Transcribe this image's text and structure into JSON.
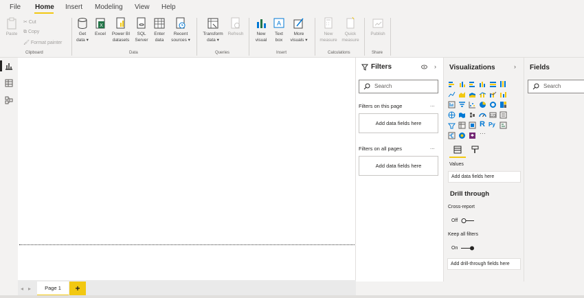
{
  "menu": {
    "tabs": [
      "File",
      "Home",
      "Insert",
      "Modeling",
      "View",
      "Help"
    ],
    "active": "Home"
  },
  "ribbon": {
    "clipboard": {
      "paste": "Paste",
      "cut": "Cut",
      "copy": "Copy",
      "format_painter": "Format painter",
      "group": "Clipboard"
    },
    "data": {
      "get_data_1": "Get",
      "get_data_2": "data ▾",
      "excel": "Excel",
      "powerbi_1": "Power BI",
      "powerbi_2": "datasets",
      "sql_1": "SQL",
      "sql_2": "Server",
      "enter_1": "Enter",
      "enter_2": "data",
      "recent_1": "Recent",
      "recent_2": "sources ▾",
      "group": "Data"
    },
    "queries": {
      "transform_1": "Transform",
      "transform_2": "data ▾",
      "refresh": "Refresh",
      "group": "Queries"
    },
    "insert": {
      "new_visual_1": "New",
      "new_visual_2": "visual",
      "text_box_1": "Text",
      "text_box_2": "box",
      "more_1": "More",
      "more_2": "visuals ▾",
      "group": "Insert"
    },
    "calculations": {
      "new_measure_1": "New",
      "new_measure_2": "measure",
      "quick_1": "Quick",
      "quick_2": "measure",
      "group": "Calculations"
    },
    "share": {
      "publish": "Publish",
      "group": "Share"
    }
  },
  "pages": {
    "tab": "Page 1",
    "add": "+",
    "prev": "◂",
    "next": "▸"
  },
  "filters": {
    "title": "Filters",
    "search_placeholder": "Search",
    "on_page": "Filters on this page",
    "on_all": "Filters on all pages",
    "add_fields": "Add data fields here",
    "dots": "..."
  },
  "visualizations": {
    "title": "Visualizations",
    "values_label": "Values",
    "values_well": "Add data fields here",
    "drill_title": "Drill through",
    "cross_report": "Cross-report",
    "off": "Off",
    "keep_filters": "Keep all filters",
    "on": "On",
    "drill_well": "Add drill-through fields here",
    "more": "···",
    "r_label": "R",
    "py_label": "Py"
  },
  "fields": {
    "title": "Fields",
    "search_placeholder": "Search"
  },
  "colors": {
    "accent": "#f2c811",
    "ribbon_bg": "#f3f2f1",
    "canvas": "#ffffff"
  }
}
